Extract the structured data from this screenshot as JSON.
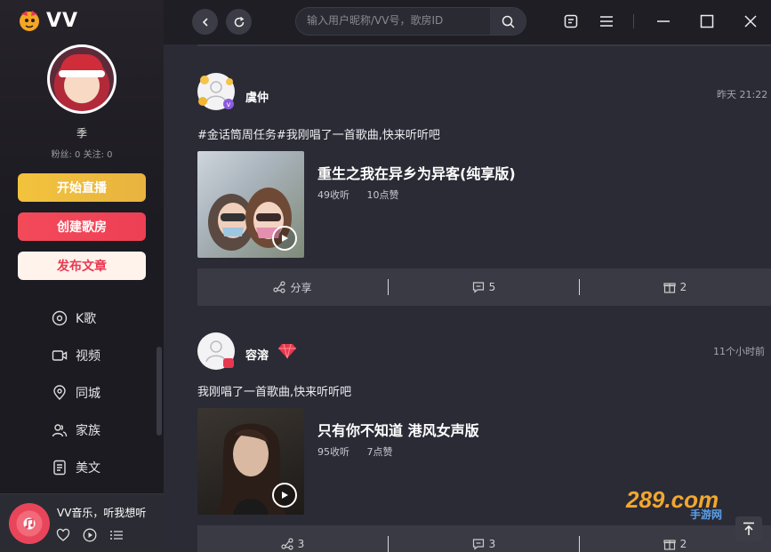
{
  "app": {
    "brand": "VV"
  },
  "profile": {
    "name": "季",
    "stats": "粉丝: 0  关注: 0"
  },
  "sidebar_buttons": {
    "live": "开始直播",
    "room": "创建歌房",
    "article": "发布文章"
  },
  "nav": [
    {
      "label": "K歌",
      "icon": "mic-disc-icon"
    },
    {
      "label": "视频",
      "icon": "video-icon"
    },
    {
      "label": "同城",
      "icon": "location-pin-icon"
    },
    {
      "label": "家族",
      "icon": "family-icon"
    },
    {
      "label": "美文",
      "icon": "document-icon"
    }
  ],
  "player": {
    "title": "VV音乐，听我想听"
  },
  "search": {
    "placeholder": "输入用户昵称/VV号，歌房ID"
  },
  "posts": [
    {
      "name": "虞仲",
      "time": "昨天 21:22",
      "text": "#金话筒周任务#我刚唱了一首歌曲,快来听听吧",
      "song": "重生之我在异乡为异客(纯享版)",
      "plays": "49收听",
      "likes": "10点赞",
      "share": "分享",
      "comments": "5",
      "gifts": "2"
    },
    {
      "name": "容溶",
      "time": "11个小时前",
      "text": "我刚唱了一首歌曲,快来听听吧",
      "song": "只有你不知道 港风女声版",
      "plays": "95收听",
      "likes": "7点赞",
      "share": "3",
      "comments": "3",
      "gifts": "2"
    }
  ],
  "watermark": {
    "text": "289.com",
    "sub": "手游网"
  }
}
